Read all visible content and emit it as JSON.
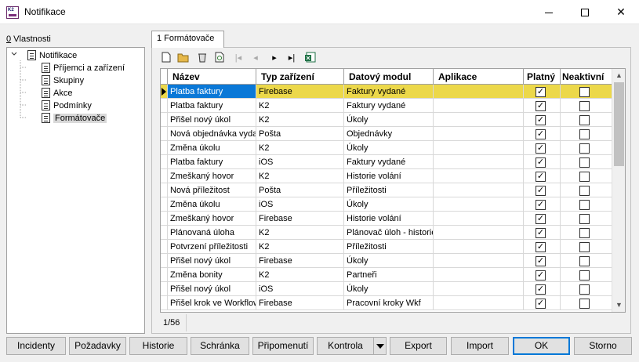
{
  "window": {
    "title": "Notifikace",
    "app_icon_text": "K2"
  },
  "left_panel": {
    "label_prefix": "0",
    "label_rest": " Vlastnosti",
    "tree": [
      {
        "label": "Notifikace",
        "level": 0,
        "expanded": true
      },
      {
        "label": "Příjemci a zařízení",
        "level": 1
      },
      {
        "label": "Skupiny",
        "level": 1
      },
      {
        "label": "Akce",
        "level": 1
      },
      {
        "label": "Podmínky",
        "level": 1
      },
      {
        "label": "Formátovače",
        "level": 1,
        "selected": true
      }
    ]
  },
  "tab": {
    "label": "1 Formátovače"
  },
  "grid": {
    "columns": [
      "Název",
      "Typ zařízení",
      "Datový modul",
      "Aplikace",
      "Platný",
      "Neaktivní"
    ],
    "rows": [
      {
        "nazev": "Platba faktury",
        "typ": "Firebase",
        "modul": "Faktury vydané",
        "aplikace": "",
        "platny": true,
        "neaktivni": false,
        "current": true
      },
      {
        "nazev": "Platba faktury",
        "typ": "K2",
        "modul": "Faktury vydané",
        "aplikace": "",
        "platny": true,
        "neaktivni": false
      },
      {
        "nazev": "Přišel nový úkol",
        "typ": "K2",
        "modul": "Úkoly",
        "aplikace": "",
        "platny": true,
        "neaktivni": false
      },
      {
        "nazev": "Nová objednávka vyda",
        "typ": "Pošta",
        "modul": "Objednávky",
        "aplikace": "",
        "platny": true,
        "neaktivni": false
      },
      {
        "nazev": "Změna úkolu",
        "typ": "K2",
        "modul": "Úkoly",
        "aplikace": "",
        "platny": true,
        "neaktivni": false
      },
      {
        "nazev": "Platba faktury",
        "typ": "iOS",
        "modul": "Faktury vydané",
        "aplikace": "",
        "platny": true,
        "neaktivni": false
      },
      {
        "nazev": "Zmeškaný hovor",
        "typ": "K2",
        "modul": "Historie volání",
        "aplikace": "",
        "platny": true,
        "neaktivni": false
      },
      {
        "nazev": "Nová příležitost",
        "typ": "Pošta",
        "modul": "Příležitosti",
        "aplikace": "",
        "platny": true,
        "neaktivni": false
      },
      {
        "nazev": "Změna úkolu",
        "typ": "iOS",
        "modul": "Úkoly",
        "aplikace": "",
        "platny": true,
        "neaktivni": false
      },
      {
        "nazev": "Zmeškaný hovor",
        "typ": "Firebase",
        "modul": "Historie volání",
        "aplikace": "",
        "platny": true,
        "neaktivni": false
      },
      {
        "nazev": "Plánovaná úloha",
        "typ": "K2",
        "modul": "Plánovač úloh - historie",
        "aplikace": "",
        "platny": true,
        "neaktivni": false
      },
      {
        "nazev": "Potvrzení příležitosti",
        "typ": "K2",
        "modul": "Příležitosti",
        "aplikace": "",
        "platny": true,
        "neaktivni": false
      },
      {
        "nazev": "Přišel nový úkol",
        "typ": "Firebase",
        "modul": "Úkoly",
        "aplikace": "",
        "platny": true,
        "neaktivni": false
      },
      {
        "nazev": "Změna bonity",
        "typ": "K2",
        "modul": "Partneři",
        "aplikace": "",
        "platny": true,
        "neaktivni": false
      },
      {
        "nazev": "Přišel nový úkol",
        "typ": "iOS",
        "modul": "Úkoly",
        "aplikace": "",
        "platny": true,
        "neaktivni": false
      },
      {
        "nazev": "Přišel krok ve Workflow",
        "typ": "Firebase",
        "modul": "Pracovní kroky Wkf",
        "aplikace": "",
        "platny": true,
        "neaktivni": false
      }
    ]
  },
  "status": {
    "record_position": "1/56"
  },
  "buttons": {
    "incidenty": "Incidenty",
    "pozadavky": "Požadavky",
    "historie": "Historie",
    "schranka": "Schránka",
    "pripomenuti": "Připomenutí",
    "kontrola": "Kontrola",
    "export": "Export",
    "import": "Import",
    "ok": "OK",
    "storno": "Storno"
  },
  "colors": {
    "current_row": "#ecd84a",
    "selected_cell": "#0a78d7"
  }
}
